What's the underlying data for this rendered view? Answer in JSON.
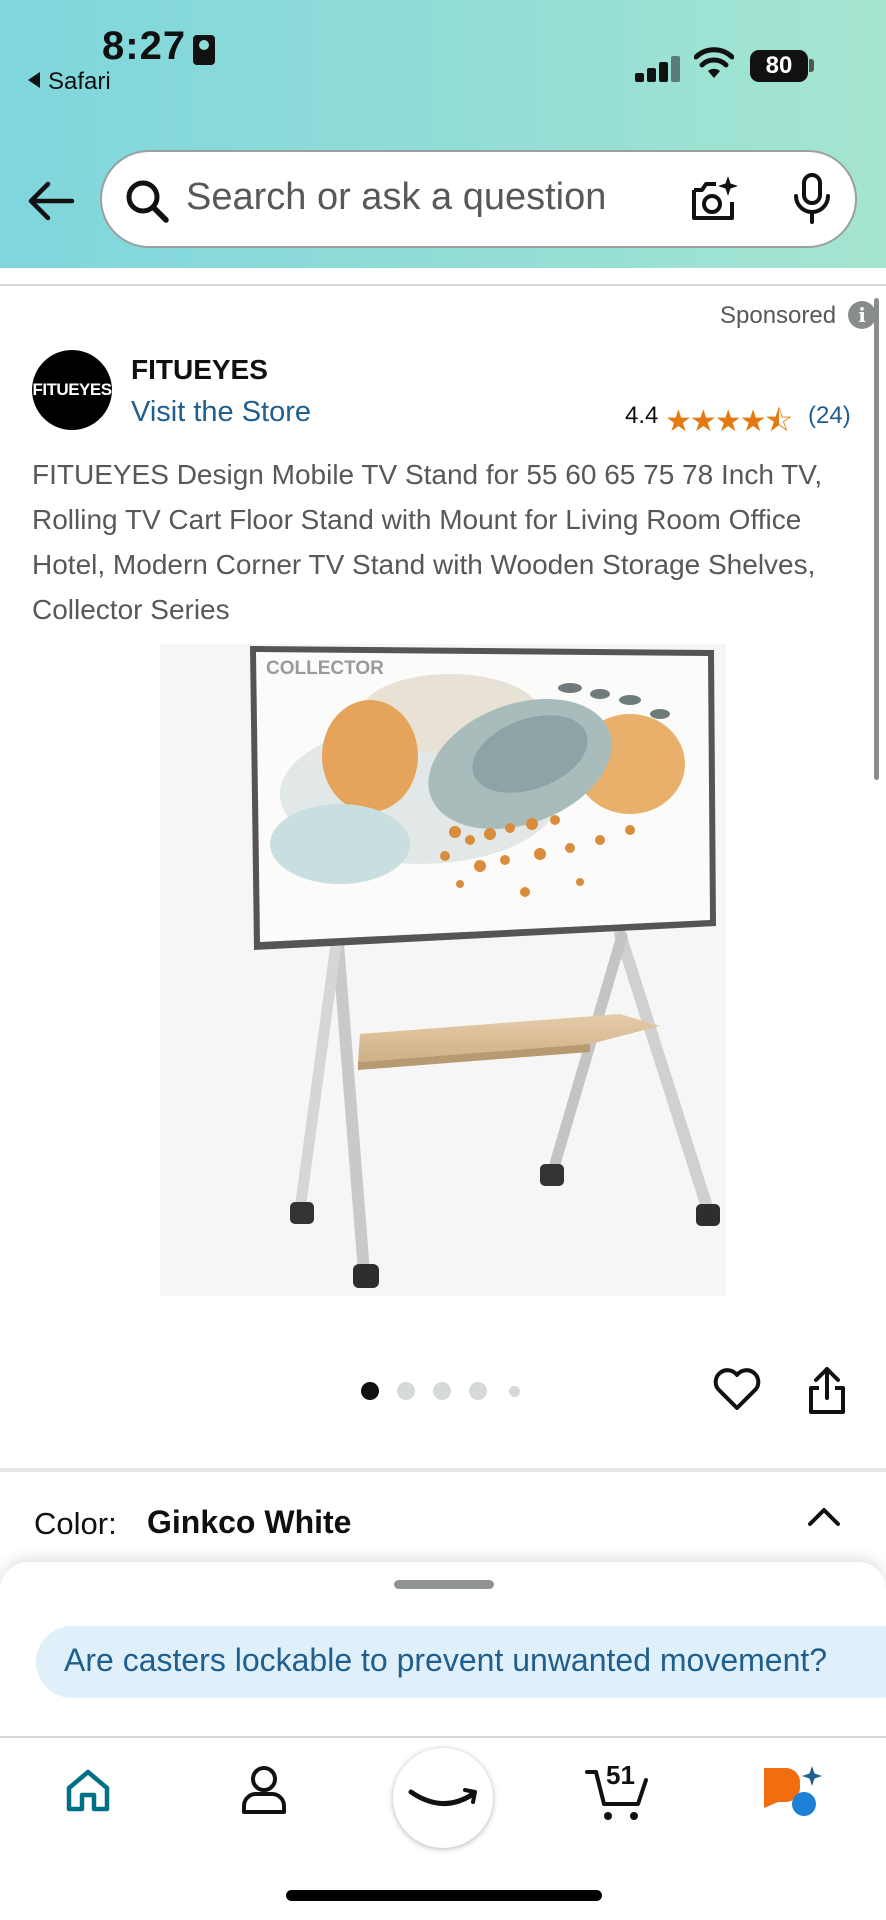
{
  "status_bar": {
    "time": "8:27",
    "back_app": "Safari",
    "battery": "80"
  },
  "search": {
    "placeholder": "Search or ask a question"
  },
  "listing": {
    "sponsored_label": "Sponsored",
    "info_glyph": "i",
    "brand_logo_text": "FITUEYES",
    "brand_name": "FITUEYES",
    "visit_store": "Visit the Store",
    "rating": "4.4",
    "stars_glyph": "★★★★⯪",
    "rating_count": "(24)",
    "title": "FITUEYES Design Mobile TV Stand for 55 60 65 75 78 Inch TV, Rolling TV Cart Floor Stand with Mount for Living Room Office Hotel, Modern Corner TV Stand with Wooden Storage Shelves, Collector Series",
    "image_caption": "COLLECTOR",
    "image_count": 5,
    "active_image": 1
  },
  "variation": {
    "label": "Color:",
    "value": "Ginkco White"
  },
  "suggestion": {
    "question": "Are casters lockable to prevent unwanted movement?"
  },
  "nav": {
    "cart_count": "51",
    "items": [
      "home-icon",
      "account-icon",
      "amazon-icon",
      "cart-icon",
      "rufus-icon"
    ]
  },
  "colors": {
    "header_start": "#7fd6dc",
    "header_end": "#a5e5d0",
    "link": "#1f5e8d",
    "star": "#e47911",
    "nav_active": "#007185"
  }
}
